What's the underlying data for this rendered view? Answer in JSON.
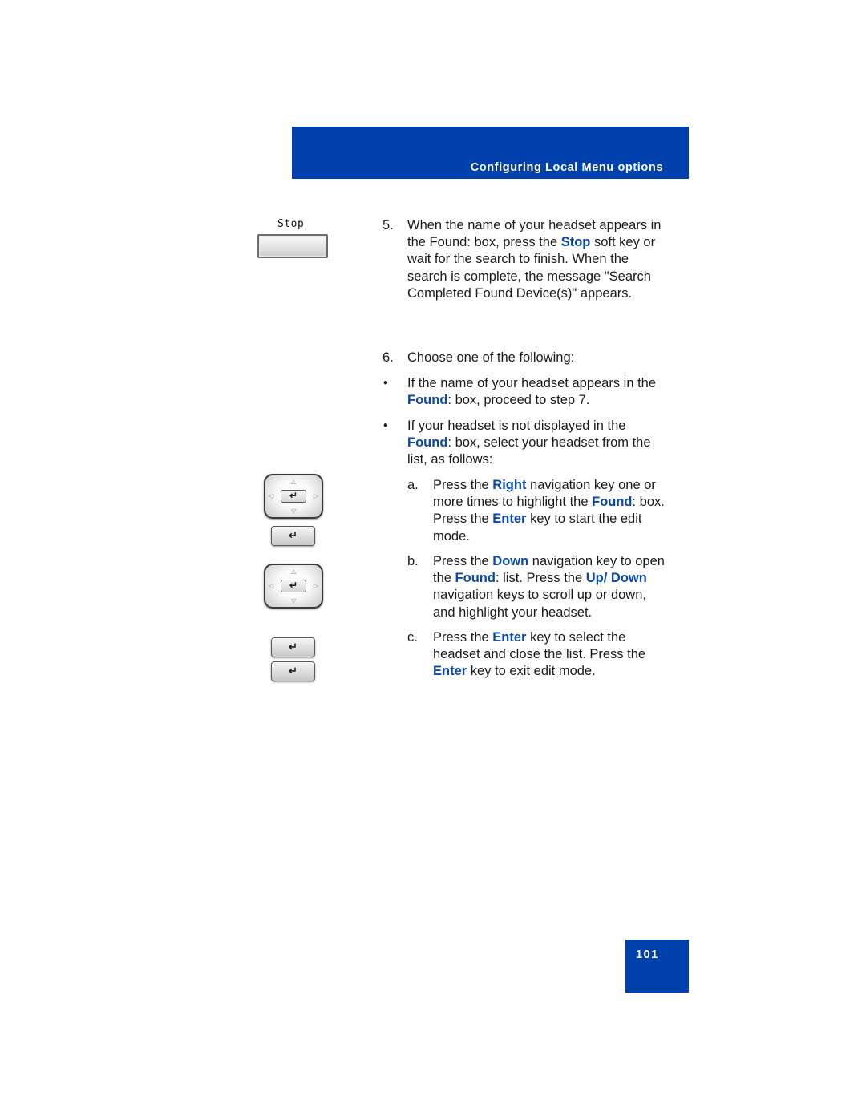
{
  "header": {
    "title": "Configuring Local Menu options"
  },
  "footer": {
    "page_number": "101"
  },
  "icons": {
    "softkey_label": "Stop",
    "enter_glyph": "↵",
    "arrow_up": "△",
    "arrow_down": "▽",
    "arrow_left": "◁",
    "arrow_right": "▷"
  },
  "steps": {
    "step5": {
      "number": "5.",
      "part1": "When the name of your headset appears in the Found: box, press the ",
      "kw1": "Stop",
      "part2": " soft key or wait for the search to finish. When the search is complete, the message \"Search Completed Found Device(s)\" appears."
    },
    "step6": {
      "number": "6.",
      "text": "Choose one of the following:",
      "bullets": [
        {
          "marker": "•",
          "part1": "If the name of your headset appears in the ",
          "kw1": "Found",
          "part2": ": box, proceed to step 7."
        },
        {
          "marker": "•",
          "part1": "If your headset is not displayed in the ",
          "kw1": "Found",
          "part2": ": box, select your headset from the list, as follows:"
        }
      ],
      "substeps": [
        {
          "marker": "a.",
          "p1": "Press the ",
          "k1": "Right",
          "p2": " navigation key one or more times to highlight the ",
          "k2": "Found",
          "p3": ": box. Press the ",
          "k3": "Enter",
          "p4": " key to start the edit mode."
        },
        {
          "marker": "b.",
          "p1": "Press the ",
          "k1": "Down",
          "p2": " navigation key to open the ",
          "k2": "Found",
          "p3": ": list. Press the ",
          "k3": "Up/ Down",
          "p4": " navigation keys to scroll up or down, and highlight your headset."
        },
        {
          "marker": "c.",
          "p1": "Press the ",
          "k1": "Enter",
          "p2": " key to select the headset and close the list. Press the ",
          "k2": "Enter",
          "p3": " key to exit edit mode."
        }
      ]
    }
  }
}
